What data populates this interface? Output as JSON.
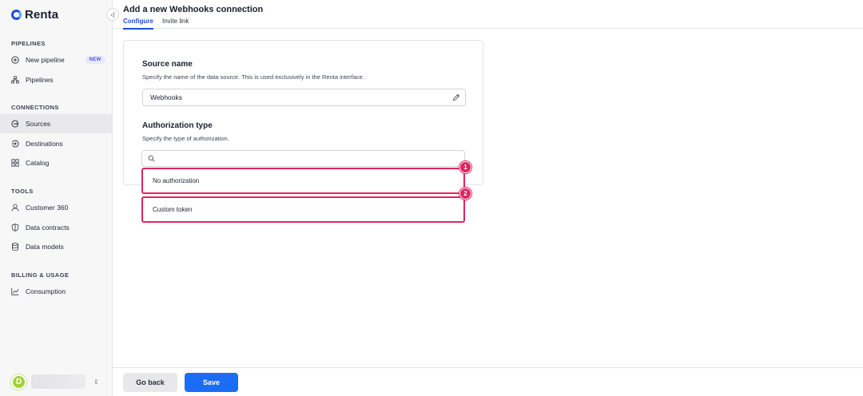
{
  "app": {
    "name": "Renta"
  },
  "sidebar": {
    "sections": [
      {
        "title": "PIPELINES"
      },
      {
        "title": "CONNECTIONS"
      },
      {
        "title": "TOOLS"
      },
      {
        "title": "BILLING & USAGE"
      }
    ],
    "items": [
      {
        "label": "New pipeline",
        "icon": "plus-circle-icon",
        "badge": "NEW"
      },
      {
        "label": "Pipelines",
        "icon": "pipelines-icon"
      },
      {
        "label": "Sources",
        "icon": "sources-icon",
        "active": true
      },
      {
        "label": "Destinations",
        "icon": "destinations-icon"
      },
      {
        "label": "Catalog",
        "icon": "grid-icon"
      },
      {
        "label": "Customer 360",
        "icon": "user-icon"
      },
      {
        "label": "Data contracts",
        "icon": "shield-icon"
      },
      {
        "label": "Data models",
        "icon": "database-icon"
      },
      {
        "label": "Consumption",
        "icon": "chart-line-icon"
      }
    ],
    "user": {
      "avatar_letter": "D"
    }
  },
  "header": {
    "title": "Add a new Webhooks connection",
    "tabs": [
      {
        "label": "Configure",
        "active": true
      },
      {
        "label": "Invite link",
        "active": false
      }
    ]
  },
  "form": {
    "source_name": {
      "title": "Source name",
      "description": "Specify the name of the data source. This is used exclusively in the Renta interface.",
      "value": "Webhooks"
    },
    "authorization": {
      "title": "Authorization type",
      "description": "Specify the type of authorization.",
      "search_value": "",
      "options": [
        {
          "label": "No authorization",
          "marker": "1"
        },
        {
          "label": "Custom token",
          "marker": "2"
        }
      ]
    }
  },
  "footer": {
    "back_label": "Go back",
    "save_label": "Save"
  },
  "colors": {
    "accent": "#1d4ed8",
    "primary_button": "#1a6cf5",
    "highlight": "#e0245e"
  }
}
